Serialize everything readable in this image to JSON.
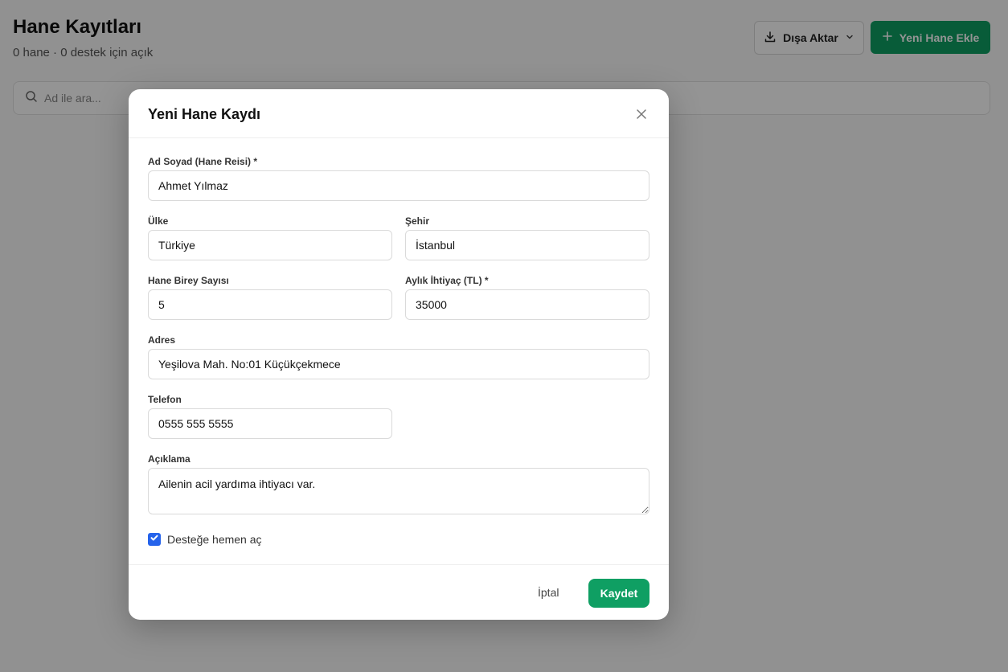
{
  "page": {
    "title": "Hane Kayıtları",
    "subtitle": "0 hane · 0 destek için açık",
    "export_label": "Dışa Aktar",
    "new_label": "Yeni Hane Ekle",
    "search_placeholder": "Ad ile ara..."
  },
  "modal": {
    "title": "Yeni Hane Kaydı",
    "fields": {
      "name": {
        "label": "Ad Soyad (Hane Reisi) *",
        "value": "Ahmet Yılmaz"
      },
      "country": {
        "label": "Ülke",
        "value": "Türkiye"
      },
      "city": {
        "label": "Şehir",
        "value": "İstanbul"
      },
      "members": {
        "label": "Hane Birey Sayısı",
        "value": "5"
      },
      "need": {
        "label": "Aylık İhtiyaç (TL) *",
        "value": "35000"
      },
      "address": {
        "label": "Adres",
        "value": "Yeşilova Mah. No:01 Küçükçekmece"
      },
      "phone": {
        "label": "Telefon",
        "value": "0555 555 5555"
      },
      "description": {
        "label": "Açıklama",
        "value": "Ailenin acil yardıma ihtiyacı var."
      }
    },
    "open_support": {
      "label": "Desteğe hemen aç",
      "checked": true
    },
    "cancel_label": "İptal",
    "save_label": "Kaydet"
  },
  "colors": {
    "primary": "#0f9f63",
    "checkbox": "#2563eb",
    "overlay": "rgba(0,0,0,0.42)"
  },
  "icons": [
    "download-icon",
    "chevron-down-icon",
    "plus-icon",
    "search-icon",
    "close-icon",
    "check-icon"
  ]
}
